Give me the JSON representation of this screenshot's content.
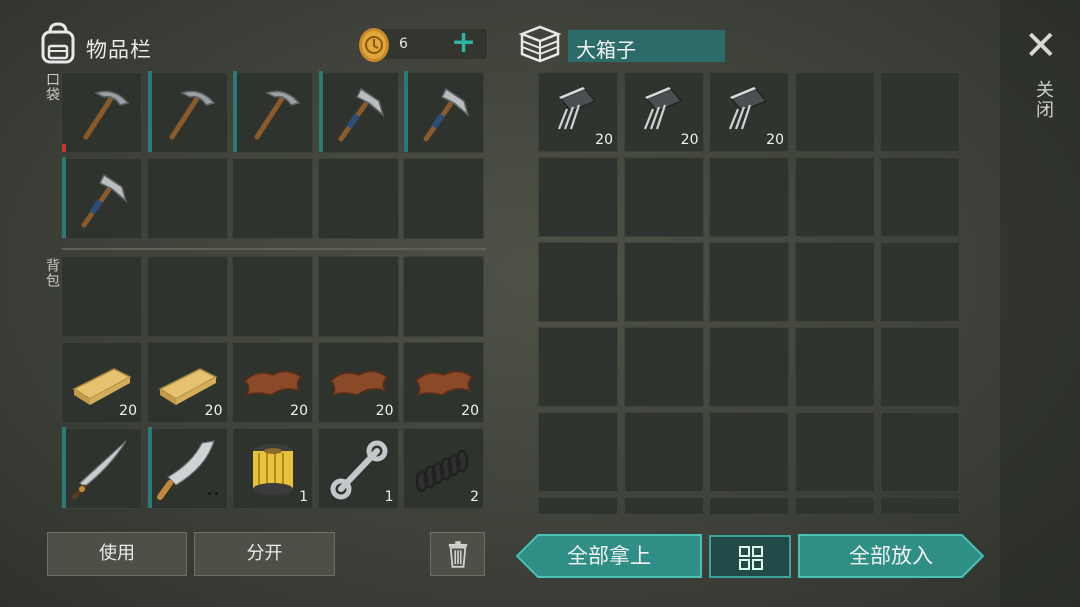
{
  "inventory": {
    "title": "物品栏",
    "icon": "backpack-icon",
    "coins": "6",
    "coin_plus": "+",
    "pocket_label": "口袋",
    "bag_label": "背包",
    "pocket_slots": [
      {
        "item": "pickaxe",
        "qty": "",
        "durability": 0.1,
        "dur_color": "#c0392b"
      },
      {
        "item": "pickaxe",
        "qty": "",
        "durability": 1.0
      },
      {
        "item": "pickaxe",
        "qty": "",
        "durability": 1.0
      },
      {
        "item": "hammer",
        "qty": "",
        "durability": 1.0
      },
      {
        "item": "hammer",
        "qty": "",
        "durability": 1.0
      },
      {
        "item": "hammer",
        "qty": "",
        "durability": 1.0
      },
      {
        "item": "",
        "qty": ""
      },
      {
        "item": "",
        "qty": ""
      },
      {
        "item": "",
        "qty": ""
      },
      {
        "item": "",
        "qty": ""
      }
    ],
    "bag_slots": [
      {
        "item": "",
        "qty": ""
      },
      {
        "item": "",
        "qty": ""
      },
      {
        "item": "",
        "qty": ""
      },
      {
        "item": "",
        "qty": ""
      },
      {
        "item": "",
        "qty": ""
      },
      {
        "item": "wood-plank",
        "qty": "20"
      },
      {
        "item": "wood-plank",
        "qty": "20"
      },
      {
        "item": "leather",
        "qty": "20"
      },
      {
        "item": "leather",
        "qty": "20"
      },
      {
        "item": "leather",
        "qty": "20"
      },
      {
        "item": "machete",
        "qty": "",
        "durability": 1.0
      },
      {
        "item": "cleaver",
        "qty": "",
        "durability": 1.0,
        "dots": "••"
      },
      {
        "item": "oil-filter",
        "qty": "1"
      },
      {
        "item": "wrench",
        "qty": "1"
      },
      {
        "item": "spring",
        "qty": "2"
      }
    ]
  },
  "box": {
    "title": "大箱子",
    "icon": "box-icon",
    "slots": [
      {
        "item": "transistor",
        "qty": "20"
      },
      {
        "item": "transistor",
        "qty": "20"
      },
      {
        "item": "transistor",
        "qty": "20"
      },
      {
        "item": "",
        "qty": ""
      },
      {
        "item": "",
        "qty": ""
      }
    ]
  },
  "buttons": {
    "use": "使用",
    "split": "分开",
    "trash": "trash-icon",
    "take_all": "全部拿上",
    "sort": "grid-icon",
    "put_all": "全部放入"
  },
  "close": {
    "label": "关闭"
  },
  "colors": {
    "accent": "#2fb3a3",
    "teal_dark": "#2b6b6a",
    "durability": "#2c7a78",
    "durability_low": "#c0392b"
  }
}
